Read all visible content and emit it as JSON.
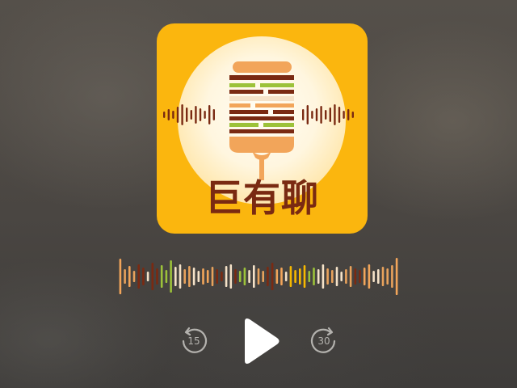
{
  "podcast": {
    "logo_text": "巨有聊",
    "artwork_icon": "burger-microphone-icon",
    "colors": {
      "background": "#fbb60e",
      "burger_bun": "#f2a55a",
      "lettuce": "#9cc23a",
      "patty": "#7a2a12",
      "glow": "#fff8e6"
    }
  },
  "waveform": {
    "icon": "audio-waveform-icon",
    "colors": [
      "#f2a55a",
      "#7a2a12",
      "#9cc23a",
      "#f5e2c8",
      "#e8a25c",
      "#f6b800"
    ]
  },
  "player": {
    "skip_back_label": "15",
    "skip_forward_label": "30",
    "skip_back_icon": "rewind-15-icon",
    "play_icon": "play-icon",
    "skip_forward_icon": "forward-30-icon",
    "icon_color": "#ffffff"
  }
}
